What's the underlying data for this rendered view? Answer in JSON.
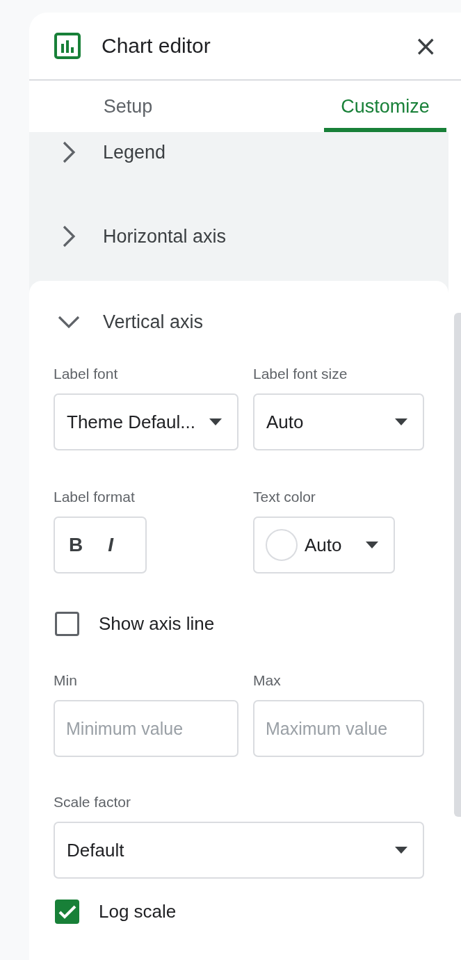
{
  "header": {
    "title": "Chart editor",
    "close": "×"
  },
  "tabs": [
    {
      "label": "Setup",
      "selected": false
    },
    {
      "label": "Customize",
      "selected": true
    }
  ],
  "sections": [
    {
      "title": "Legend",
      "expanded": false
    },
    {
      "title": "Horizontal axis",
      "expanded": false
    },
    {
      "title": "Vertical axis",
      "expanded": true
    }
  ],
  "vertical_axis": {
    "label_font": {
      "label": "Label font",
      "value": "Theme Defaul..."
    },
    "label_font_size": {
      "label": "Label font size",
      "value": "Auto"
    },
    "label_format": {
      "label": "Label format",
      "bold": "B",
      "italic": "I"
    },
    "text_color": {
      "label": "Text color",
      "value": "Auto"
    },
    "show_axis_line": {
      "label": "Show axis line",
      "checked": false
    },
    "min": {
      "label": "Min",
      "placeholder": "Minimum value"
    },
    "max": {
      "label": "Max",
      "placeholder": "Maximum value"
    },
    "scale_factor": {
      "label": "Scale factor",
      "value": "Default"
    },
    "log_scale": {
      "label": "Log scale",
      "checked": true
    }
  }
}
